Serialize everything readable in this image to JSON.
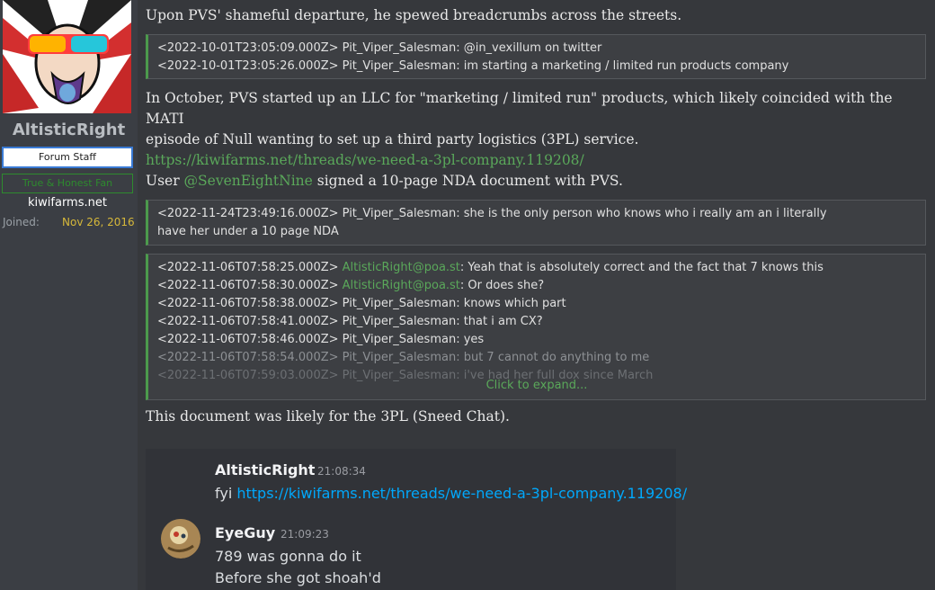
{
  "user": {
    "name": "AltisticRight",
    "badge_staff": "Forum Staff",
    "badge_fan": "True & Honest Fan",
    "site": "kiwifarms.net",
    "joined_label": "Joined:",
    "joined_value": "Nov 26, 2016"
  },
  "post": {
    "p1": "Upon PVS' shameful departure, he spewed breadcrumbs across the streets.",
    "quote1": [
      "<2022-10-01T23:05:09.000Z> Pit_Viper_Salesman: @in_vexillum on twitter",
      "<2022-10-01T23:05:26.000Z> Pit_Viper_Salesman: im starting a marketing / limited run products company"
    ],
    "p2_line1": "In October, PVS started up an LLC for \"marketing / limited run\" products, which likely coincided with the MATI",
    "p2_line2": "episode of Null wanting to set up a third party logistics (3PL) service.",
    "p2_link": "https://kiwifarms.net/threads/we-need-a-3pl-company.119208/",
    "p3_prefix": "User ",
    "p3_mention": "@SevenEightNine",
    "p3_suffix": " signed a 10-page NDA document with PVS.",
    "quote2": [
      "<2022-11-24T23:49:16.000Z> Pit_Viper_Salesman: she is the only person who knows who i really am an i literally",
      "have her under a 10 page NDA"
    ],
    "quote3": {
      "l1_ts": "<2022-11-06T07:58:25.000Z> ",
      "l1_user": "AltisticRight@poa.st",
      "l1_text": ": Yeah that is absolutely correct and the fact that 7 knows this",
      "l2_ts": "<2022-11-06T07:58:30.000Z> ",
      "l2_user": "AltisticRight@poa.st",
      "l2_text": ": Or does she?",
      "l3": "<2022-11-06T07:58:38.000Z> Pit_Viper_Salesman: knows which part",
      "l4": "<2022-11-06T07:58:41.000Z> Pit_Viper_Salesman: that i am CX?",
      "l5": "<2022-11-06T07:58:46.000Z> Pit_Viper_Salesman: yes",
      "l6": "<2022-11-06T07:58:54.000Z> Pit_Viper_Salesman: but 7 cannot do anything to me",
      "l7": "<2022-11-06T07:59:03.000Z> Pit_Viper_Salesman: i've had her full dox since March",
      "expand": "Click to expand..."
    },
    "p4": "This document was likely for the 3PL (Sneed Chat)."
  },
  "discord": {
    "m1_name": "AltisticRight",
    "m1_time": "21:08:34",
    "m1_prefix": "fyi ",
    "m1_link": "https://kiwifarms.net/threads/we-need-a-3pl-company.119208/",
    "m2_name": "EyeGuy",
    "m2_time": "21:09:23",
    "m2_line1": "789 was gonna do it",
    "m2_line2": "Before she got shoah'd"
  },
  "colors": {
    "accent_green": "#5aa85a",
    "staff_border": "#3a7bd5",
    "joined_date": "#d6b83a",
    "discord_link": "#00a8fc"
  }
}
